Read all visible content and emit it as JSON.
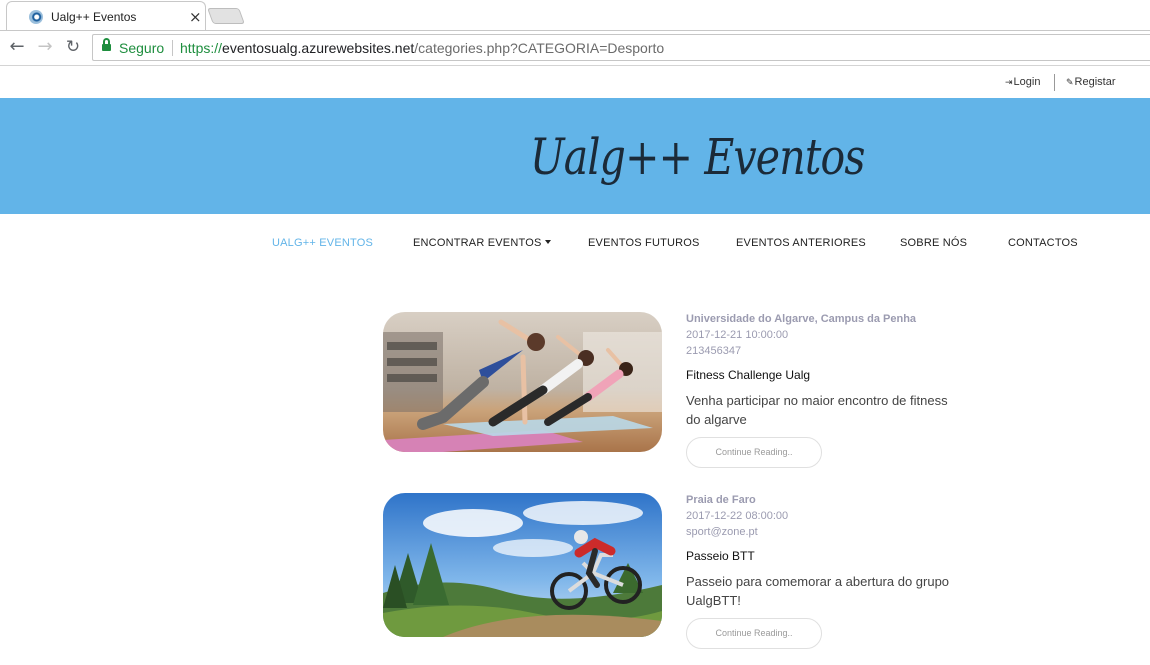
{
  "browser": {
    "tab_title": "Ualg++ Eventos",
    "tab_close": "×",
    "back_glyph": "←",
    "forward_glyph": "→",
    "reload_glyph": "↻",
    "security_label": "Seguro",
    "url_scheme": "https://",
    "url_host": "eventosualg.azurewebsites.net",
    "url_path": "/categories.php?CATEGORIA=Desporto"
  },
  "topbar": {
    "login_icon": "⇥",
    "login_label": "Login",
    "register_icon": "✎",
    "register_label": "Registar"
  },
  "banner": {
    "title": "Ualg++ Eventos",
    "background": "#62b4e8"
  },
  "nav": {
    "items": [
      {
        "label": "UALG++ EVENTOS",
        "active": true
      },
      {
        "label": "ENCONTRAR EVENTOS",
        "dropdown": true
      },
      {
        "label": "EVENTOS FUTUROS"
      },
      {
        "label": "EVENTOS ANTERIORES"
      },
      {
        "label": "SOBRE NÓS"
      },
      {
        "label": "CONTACTOS"
      }
    ],
    "active_color": "#62b4e8"
  },
  "events": [
    {
      "location": "Universidade do Algarve, Campus da Penha",
      "date": "2017-12-21 10:00:00",
      "contact": "213456347",
      "title": "Fitness Challenge Ualg",
      "description": "Venha participar no maior encontro de fitness do algarve",
      "button": "Continue Reading.."
    },
    {
      "location": "Praia de Faro",
      "date": "2017-12-22 08:00:00",
      "contact": "sport@zone.pt",
      "title": "Passeio BTT",
      "description": "Passeio para comemorar a abertura do grupo UalgBTT!",
      "button": "Continue Reading.."
    }
  ]
}
